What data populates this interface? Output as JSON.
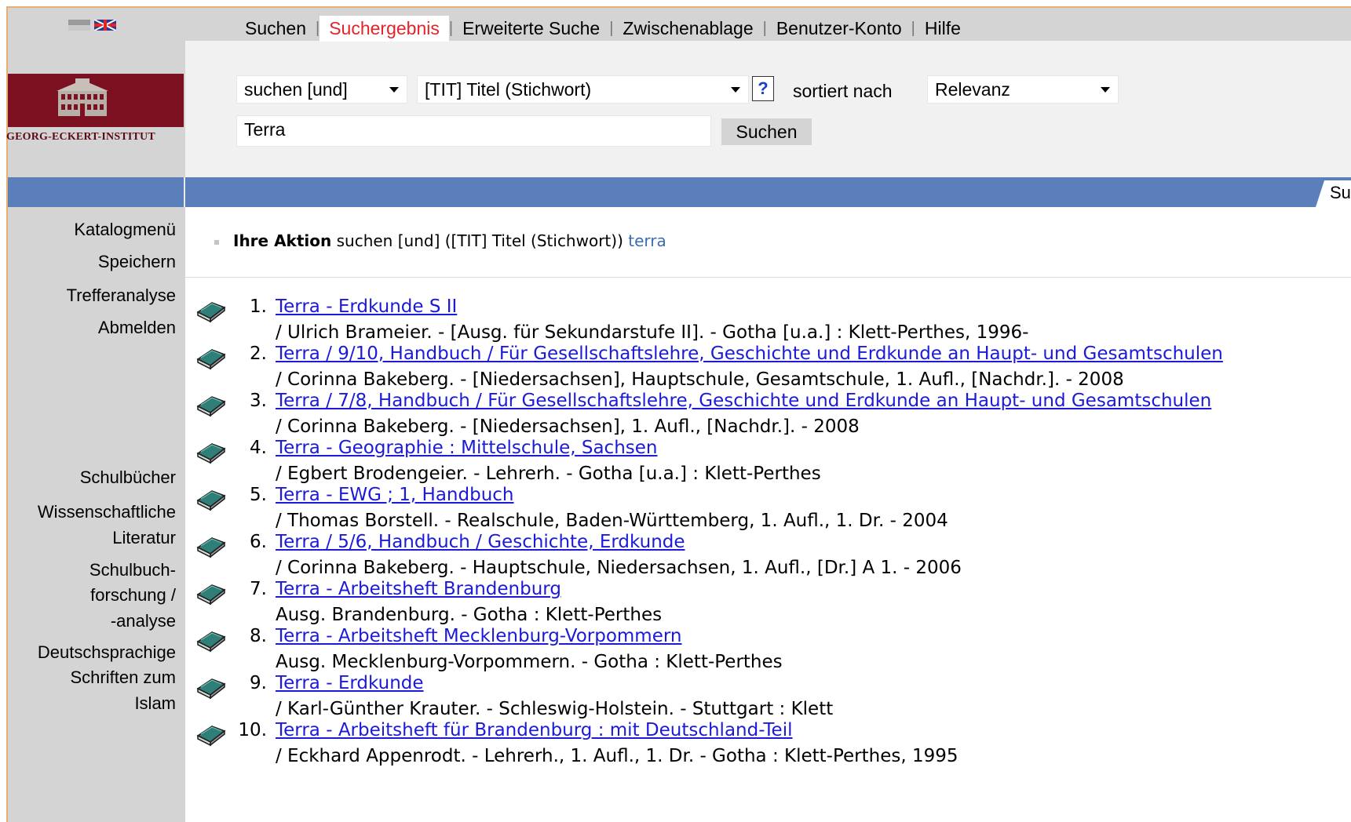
{
  "language": {
    "de_flag": "german-flag-icon",
    "en_flag": "uk-flag-icon"
  },
  "logo": {
    "text": "GEORG-ECKERT-INSTITUT"
  },
  "nav": [
    {
      "label": "Suchen"
    },
    {
      "label": "Suchergebnis",
      "active": true
    },
    {
      "label": "Erweiterte Suche"
    },
    {
      "label": "Zwischenablage"
    },
    {
      "label": "Benutzer-Konto"
    },
    {
      "label": "Hilfe"
    }
  ],
  "search": {
    "mode": "suchen [und]",
    "field": "[TIT] Titel (Stichwort)",
    "help": "?",
    "sort_label": "sortiert nach",
    "sort_value": "Relevanz",
    "query": "Terra",
    "button": "Suchen"
  },
  "bluebar": {
    "tab": "Su"
  },
  "sidebar": {
    "top": [
      "Katalogmenü",
      "Speichern",
      "Trefferanalyse",
      "Abmelden"
    ],
    "bottom": [
      "Schulbücher",
      "Wissenschaftliche",
      "Literatur",
      "Schulbuch-",
      "forschung /",
      "-analyse",
      "Deutschsprachige",
      "Schriften zum",
      "Islam"
    ]
  },
  "action": {
    "label": "Ihre Aktion",
    "text": "suchen [und] ([TIT] Titel (Stichwort))",
    "term": "terra"
  },
  "results": [
    {
      "num": "1.",
      "title": "Terra - Erdkunde S II",
      "desc": "/ Ulrich Brameier. - [Ausg. für Sekundarstufe II]. - Gotha [u.a.] : Klett-Perthes, 1996-"
    },
    {
      "num": "2.",
      "title": "Terra / 9/10, Handbuch / Für Gesellschaftslehre, Geschichte und Erdkunde an Haupt- und Gesamtschulen",
      "desc": "/ Corinna Bakeberg. - [Niedersachsen], Hauptschule, Gesamtschule, 1. Aufl., [Nachdr.]. - 2008"
    },
    {
      "num": "3.",
      "title": "Terra / 7/8, Handbuch / Für Gesellschaftslehre, Geschichte und Erdkunde an Haupt- und Gesamtschulen",
      "desc": "/ Corinna Bakeberg. - [Niedersachsen], 1. Aufl., [Nachdr.]. - 2008"
    },
    {
      "num": "4.",
      "title": "Terra - Geographie : Mittelschule, Sachsen",
      "desc": "/ Egbert Brodengeier. - Lehrerh. - Gotha [u.a.] : Klett-Perthes"
    },
    {
      "num": "5.",
      "title": "Terra - EWG ; 1, Handbuch",
      "desc": "/ Thomas Borstell. - Realschule, Baden-Württemberg, 1. Aufl., 1. Dr. - 2004"
    },
    {
      "num": "6.",
      "title": "Terra / 5/6, Handbuch / Geschichte, Erdkunde",
      "desc": "/ Corinna Bakeberg. - Hauptschule, Niedersachsen, 1. Aufl., [Dr.] A 1. - 2006"
    },
    {
      "num": "7.",
      "title": "Terra - Arbeitsheft Brandenburg",
      "desc": "Ausg. Brandenburg. - Gotha : Klett-Perthes"
    },
    {
      "num": "8.",
      "title": "Terra - Arbeitsheft Mecklenburg-Vorpommern",
      "desc": "Ausg. Mecklenburg-Vorpommern. - Gotha : Klett-Perthes"
    },
    {
      "num": "9.",
      "title": "Terra - Erdkunde",
      "desc": "/ Karl-Günther Krauter. - Schleswig-Holstein. - Stuttgart : Klett"
    },
    {
      "num": "10.",
      "title": "Terra - Arbeitsheft für Brandenburg : mit Deutschland-Teil",
      "desc": "/ Eckhard Appenrodt. - Lehrerh., 1. Aufl., 1. Dr. - Gotha : Klett-Perthes, 1995"
    }
  ],
  "colors": {
    "accent": "#e2242a",
    "link": "#1a1ad8",
    "bar": "#5b7fbb",
    "logo_bg": "#7a1020"
  }
}
